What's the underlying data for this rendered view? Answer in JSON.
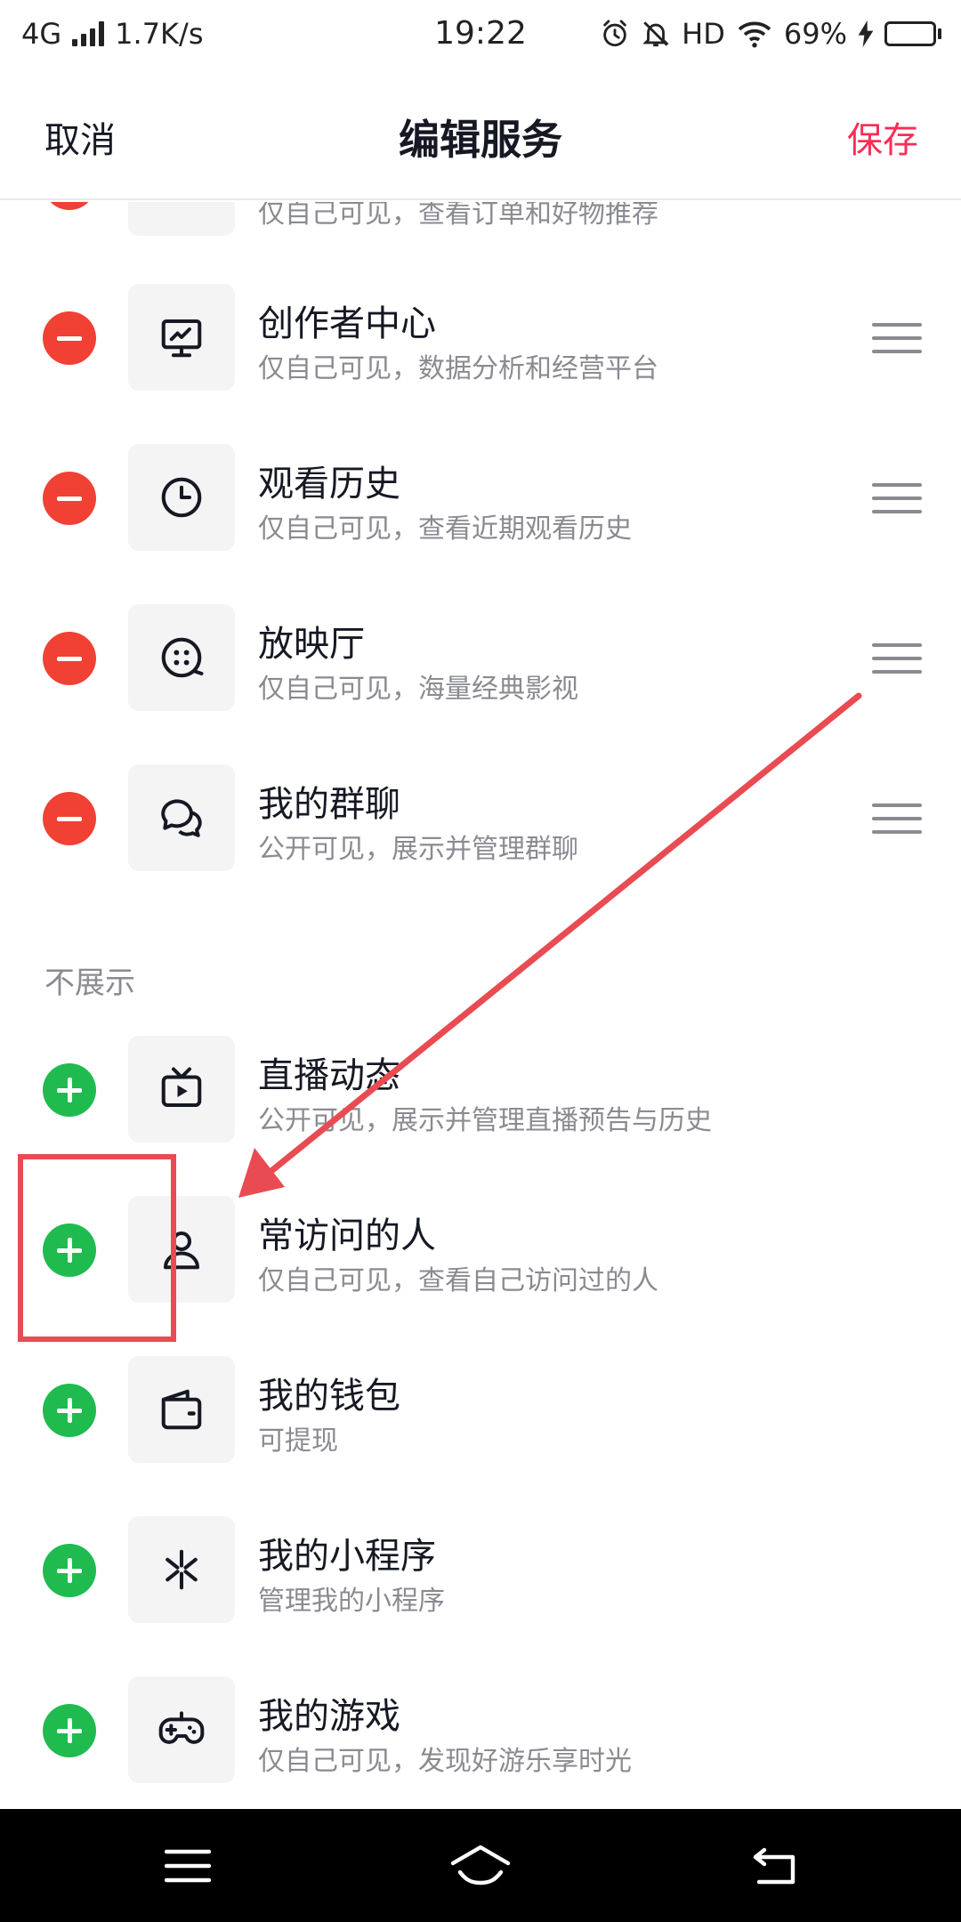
{
  "status_bar": {
    "network": "4G",
    "speed": "1.7K/s",
    "time": "19:22",
    "hd": "HD",
    "battery_percent": "69%",
    "battery_level": 0.69
  },
  "header": {
    "cancel_label": "取消",
    "title": "编辑服务",
    "save_label": "保存",
    "accent_color": "#fe2c55"
  },
  "shown_items": [
    {
      "title": "",
      "subtitle": "仅自己可见，查看订单和好物推荐",
      "icon": "cart-icon"
    },
    {
      "title": "创作者中心",
      "subtitle": "仅自己可见，数据分析和经营平台",
      "icon": "chart-monitor-icon"
    },
    {
      "title": "观看历史",
      "subtitle": "仅自己可见，查看近期观看历史",
      "icon": "clock-icon"
    },
    {
      "title": "放映厅",
      "subtitle": "仅自己可见，海量经典影视",
      "icon": "film-reel-icon"
    },
    {
      "title": "我的群聊",
      "subtitle": "公开可见，展示并管理群聊",
      "icon": "chat-bubbles-icon"
    }
  ],
  "hidden_section_label": "不展示",
  "hidden_items": [
    {
      "title": "直播动态",
      "subtitle": "公开可见，展示并管理直播预告与历史",
      "icon": "tv-play-icon"
    },
    {
      "title": "常访问的人",
      "subtitle": "仅自己可见，查看自己访问过的人",
      "icon": "person-icon"
    },
    {
      "title": "我的钱包",
      "subtitle": "可提现",
      "icon": "wallet-icon"
    },
    {
      "title": "我的小程序",
      "subtitle": "管理我的小程序",
      "icon": "asterisk-icon"
    },
    {
      "title": "我的游戏",
      "subtitle": "仅自己可见，发现好游乐享时光",
      "icon": "gamepad-icon"
    }
  ],
  "colors": {
    "remove": "#f04134",
    "add": "#1fbb4f",
    "annotation": "#e94b52"
  }
}
